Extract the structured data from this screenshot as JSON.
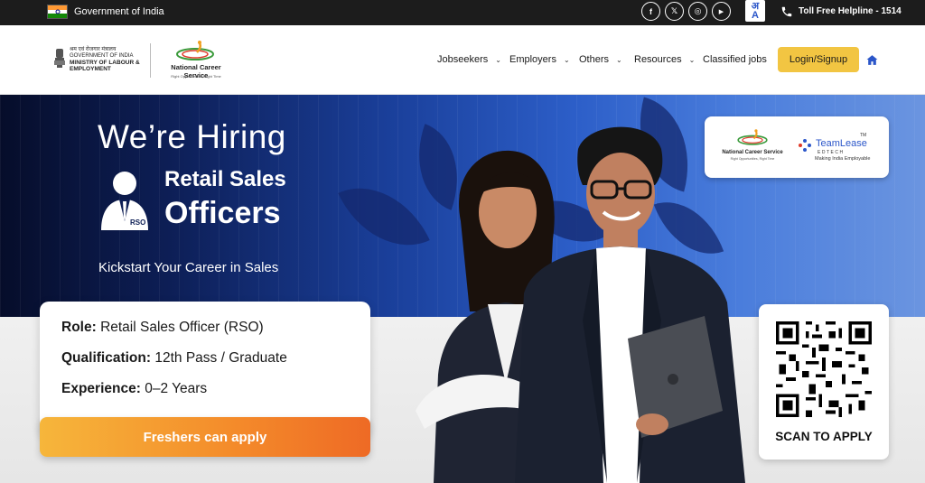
{
  "topbar": {
    "gov_label": "Government of India",
    "social_icons": [
      "facebook-icon",
      "x-icon",
      "instagram-icon",
      "youtube-icon"
    ],
    "social_glyphs": [
      "f",
      "𝕏",
      "◎",
      "▶"
    ],
    "lang_glyph_top": "अ",
    "lang_glyph_bottom": "A",
    "helpline": "Toll Free Helpline - 1514"
  },
  "header": {
    "ministry_line1": "श्रम एवं रोजगार मंत्रालय",
    "ministry_line2": "GOVERNMENT OF INDIA",
    "ministry_line3": "MINISTRY OF LABOUR &",
    "ministry_line4": "EMPLOYMENT",
    "ncs_name": "National Career Service",
    "ncs_tagline": "Right Opportunities, Right Time",
    "nav": [
      {
        "label": "Jobseekers",
        "has_dropdown": true
      },
      {
        "label": "Employers",
        "has_dropdown": true
      },
      {
        "label": "Others",
        "has_dropdown": true
      },
      {
        "label": "Resources",
        "has_dropdown": true
      },
      {
        "label": "Classified jobs",
        "has_dropdown": false
      }
    ],
    "login_label": "Login/Signup"
  },
  "banner": {
    "hiring": "We’re Hiring",
    "role_badge": "RSO",
    "title_line1": "Retail Sales",
    "title_line2": "Officers",
    "subtitle": "Kickstart Your Career in Sales",
    "partner": {
      "ncs_name": "National Career Service",
      "ncs_tagline": "Right Opportunities, Right Time",
      "teamlease": "TeamLease",
      "tm": "TM",
      "edtech": "EDTECH",
      "teamlease_tag": "Making India Employable"
    },
    "details": {
      "role_label": "Role:",
      "role_value": "Retail Sales Officer (RSO)",
      "qual_label": "Qualification:",
      "qual_value": "12th Pass / Graduate",
      "exp_label": "Experience:",
      "exp_value": "0–2 Years"
    },
    "apply_label": "Freshers can apply",
    "scan_label": "SCAN TO APPLY"
  },
  "colors": {
    "topbar_bg": "#1c1c1c",
    "login_bg": "#f2c542",
    "home_icon": "#2b56c9",
    "banner_blue": "#1a3f9a",
    "apply_gradient_start": "#f6b63b",
    "apply_gradient_end": "#ee6a25"
  }
}
